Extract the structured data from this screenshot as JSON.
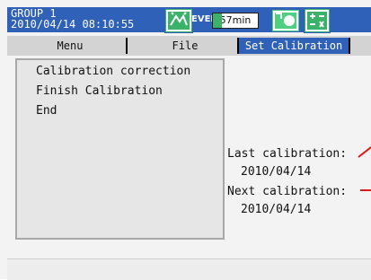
{
  "status": {
    "group": "GROUP 1",
    "datetime": "2010/04/14 08:10:55",
    "event_label": "EVENT",
    "time_remaining": "57min"
  },
  "tabs": [
    {
      "label": "Menu",
      "selected": false
    },
    {
      "label": "File",
      "selected": false
    },
    {
      "label": "Set Calibration",
      "selected": true
    }
  ],
  "menu": {
    "items": [
      {
        "label": "Calibration correction"
      },
      {
        "label": "Finish Calibration"
      },
      {
        "label": "End"
      }
    ]
  },
  "calibration": {
    "last_label": "Last calibration:",
    "last_date": "2010/04/14",
    "next_label": "Next calibration:",
    "next_date": "2010/04/14"
  },
  "colors": {
    "status_bar": "#2f61b8",
    "accent_green": "#3bb26a",
    "warning_red": "#e01818"
  },
  "icons": {
    "record": "record-icon",
    "select": "select-icon",
    "math": "math-icon"
  }
}
